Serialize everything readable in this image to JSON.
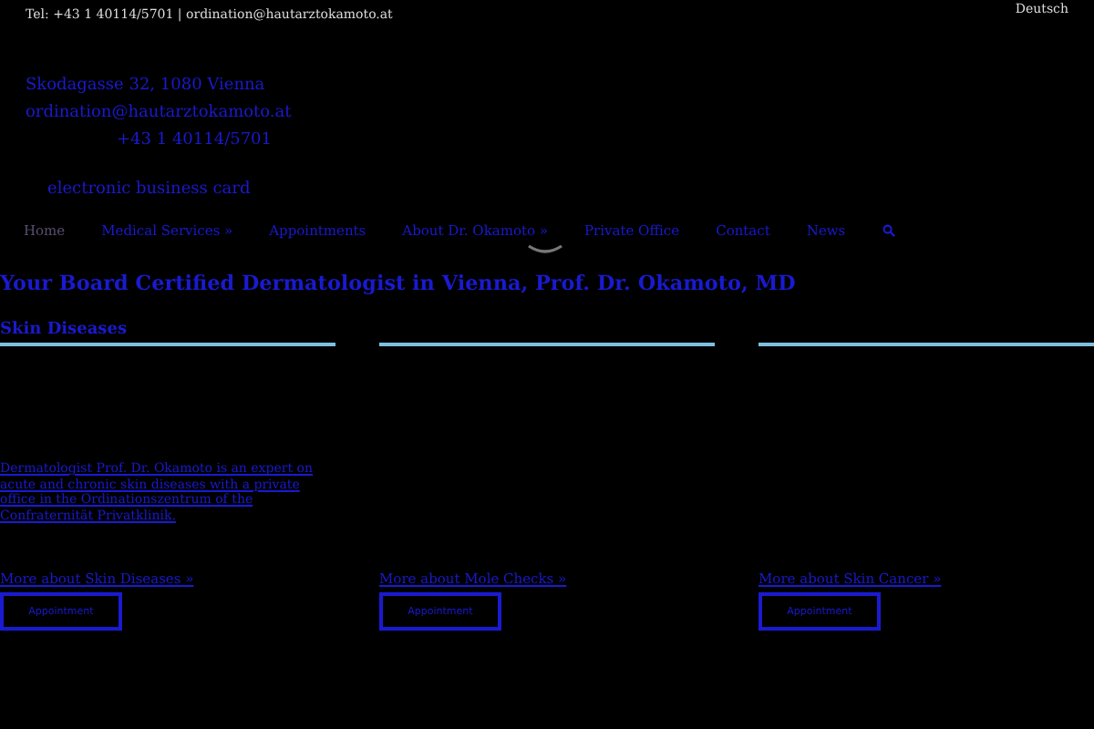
{
  "topbar": {
    "contact": "Tel: +43 1 40114/5701 | ordination@hautarztokamoto.at",
    "language": "Deutsch"
  },
  "contact_block": {
    "address": "Skodagasse 32, 1080 Vienna",
    "email": "ordination@hautarztokamoto.at",
    "phone": "+43 1 40114/5701",
    "business_card": "electronic business card"
  },
  "nav": {
    "items": [
      {
        "label": "Home",
        "selected": true
      },
      {
        "label": "Medical Services »",
        "selected": false
      },
      {
        "label": "Appointments",
        "selected": false
      },
      {
        "label": "About Dr. Okamoto »",
        "selected": false
      },
      {
        "label": "Private Office",
        "selected": false
      },
      {
        "label": "Contact",
        "selected": false
      },
      {
        "label": "News",
        "selected": false
      }
    ]
  },
  "heading": "Your Board Certified Dermatologist in Vienna, Prof. Dr. Okamoto, MD",
  "columns": [
    {
      "title": "Skin Diseases",
      "text": "Dermatologist Prof. Dr. Okamoto is an expert on acute and chronic skin diseases with a private office in the Ordinationszentrum of the Confraternität Privatklinik.",
      "link": "More about Skin Diseases »",
      "button": "Appointment"
    },
    {
      "link": "More about Mole Checks »",
      "button": "Appointment"
    },
    {
      "link": "More about Skin Cancer »",
      "button": "Appointment"
    }
  ]
}
